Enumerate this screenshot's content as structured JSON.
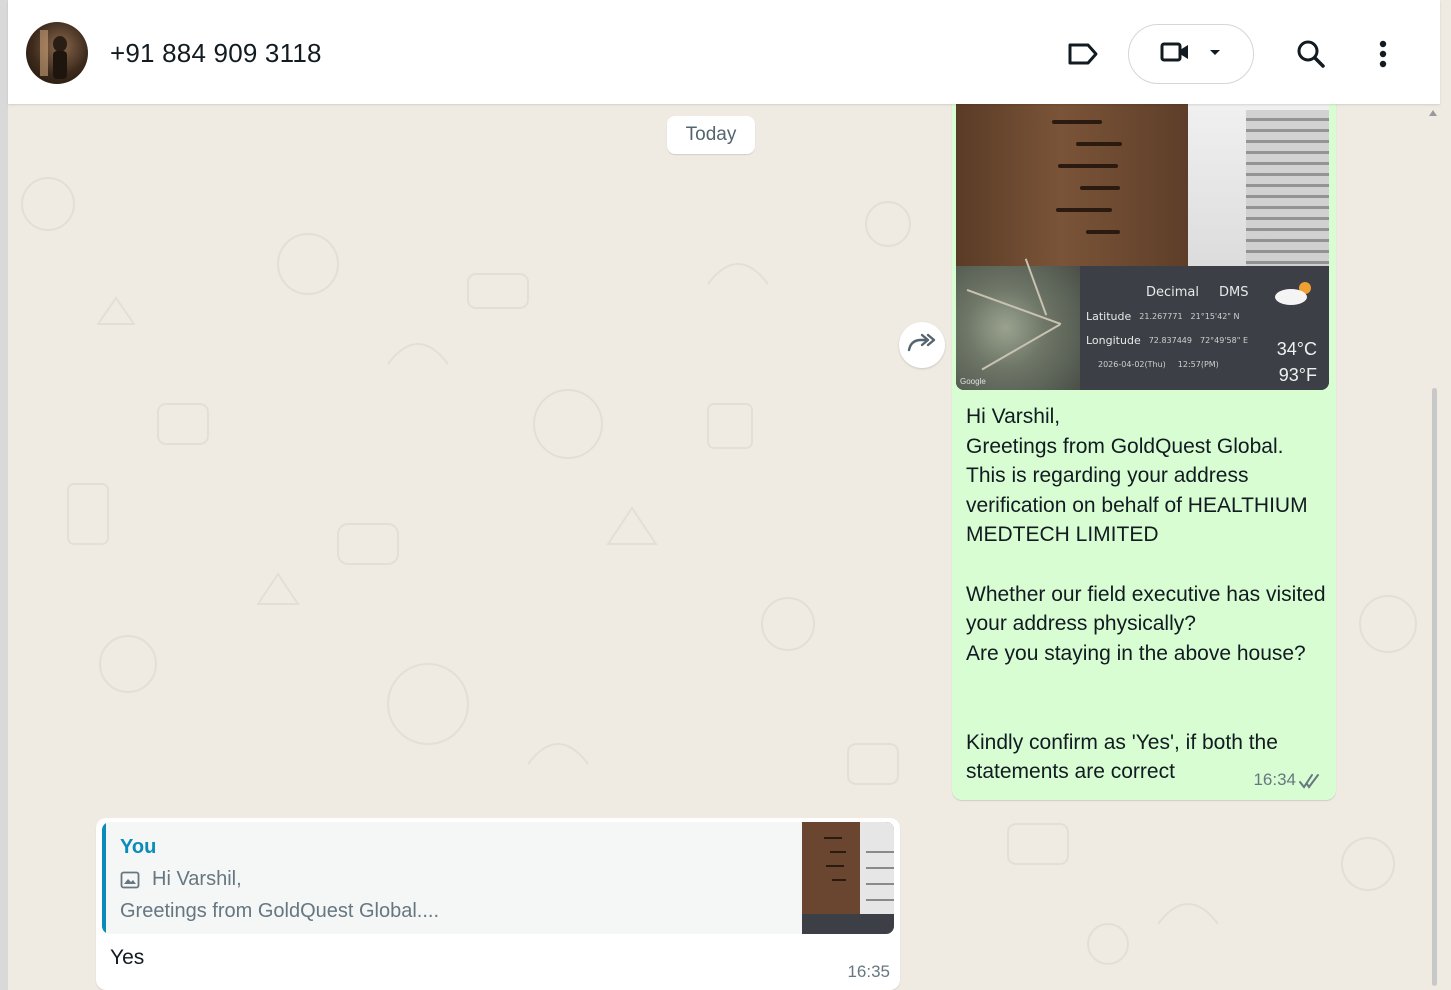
{
  "header": {
    "contact_name": "+91 884 909 3118",
    "icons": [
      "label-icon",
      "video-call-icon",
      "chevron-down-icon",
      "search-icon",
      "more-vertical-icon"
    ]
  },
  "chat": {
    "date_divider": "Today",
    "outgoing": {
      "photo": {
        "geo_header_decimal": "Decimal",
        "geo_header_dms": "DMS",
        "latitude_label": "Latitude",
        "latitude_decimal": "21.267771",
        "latitude_dms": "21°15'42\" N",
        "longitude_label": "Longitude",
        "longitude_decimal": "72.837449",
        "longitude_dms": "72°49'58\" E",
        "datetime": "2026-04-02(Thu)",
        "time": "12:57(PM)",
        "temp_c": "34°C",
        "temp_f": "93°F",
        "map_credit": "Google"
      },
      "text": "Hi Varshil,\nGreetings from GoldQuest Global.\nThis is regarding your address verification on behalf of HEALTHIUM MEDTECH LIMITED\n\nWhether our field executive has visited your address physically?\nAre you staying in the above house?\n\n\nKindly confirm as 'Yes', if both the statements are correct",
      "time": "16:34",
      "status": "read"
    },
    "incoming": {
      "quoted_author": "You",
      "quoted_line1": "Hi Varshil,",
      "quoted_line2": "Greetings from GoldQuest Global....",
      "text": "Yes",
      "time": "16:35"
    }
  },
  "colors": {
    "outgoing_bubble": "#d9fdd3",
    "incoming_bubble": "#ffffff",
    "chat_background": "#efeae2",
    "quote_accent": "#0b8bba"
  }
}
